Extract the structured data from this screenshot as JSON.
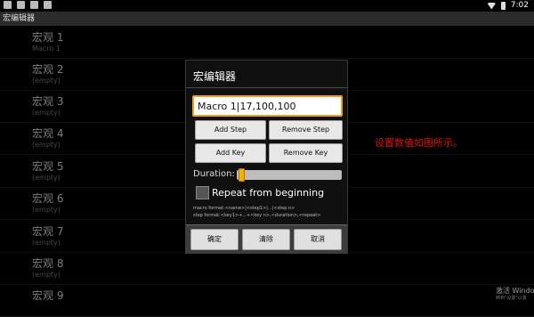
{
  "status_bar": {
    "time": "7:02"
  },
  "app": {
    "title": "宏编辑器"
  },
  "macros": [
    {
      "name": "宏观 1",
      "detail": "Macro 1"
    },
    {
      "name": "宏观 2",
      "detail": "(empty)"
    },
    {
      "name": "宏观 3",
      "detail": "(empty)"
    },
    {
      "name": "宏观 4",
      "detail": "(empty)"
    },
    {
      "name": "宏观 5",
      "detail": "(empty)"
    },
    {
      "name": "宏观 6",
      "detail": "(empty)"
    },
    {
      "name": "宏观 7",
      "detail": "(empty)"
    },
    {
      "name": "宏观 8",
      "detail": "(empty)"
    },
    {
      "name": "宏观 9",
      "detail": ""
    }
  ],
  "dialog": {
    "title": "宏编辑器",
    "macro_value": "Macro 1|17,100,100",
    "add_step": "Add Step",
    "remove_step": "Remove Step",
    "add_key": "Add Key",
    "remove_key": "Remove Key",
    "duration_label": "Duration:",
    "duration_level": 0.02,
    "repeat_label": "Repeat from beginning",
    "repeat_checked": false,
    "help_line1": "macro format:<name>|<step1>|...|<step n>",
    "help_line2": "step format:<key1>+...+<key n>,<duration>,<repeat>",
    "ok": "确定",
    "clear": "清除",
    "cancel": "取消"
  },
  "annotation": "设置数值如图所示。",
  "watermark": {
    "line1": "激活 Windo",
    "line2": "转到\"设置\"以激"
  },
  "colors": {
    "accent": "#f0a020",
    "annotation": "#e01010",
    "dialog_bg": "#101010"
  }
}
